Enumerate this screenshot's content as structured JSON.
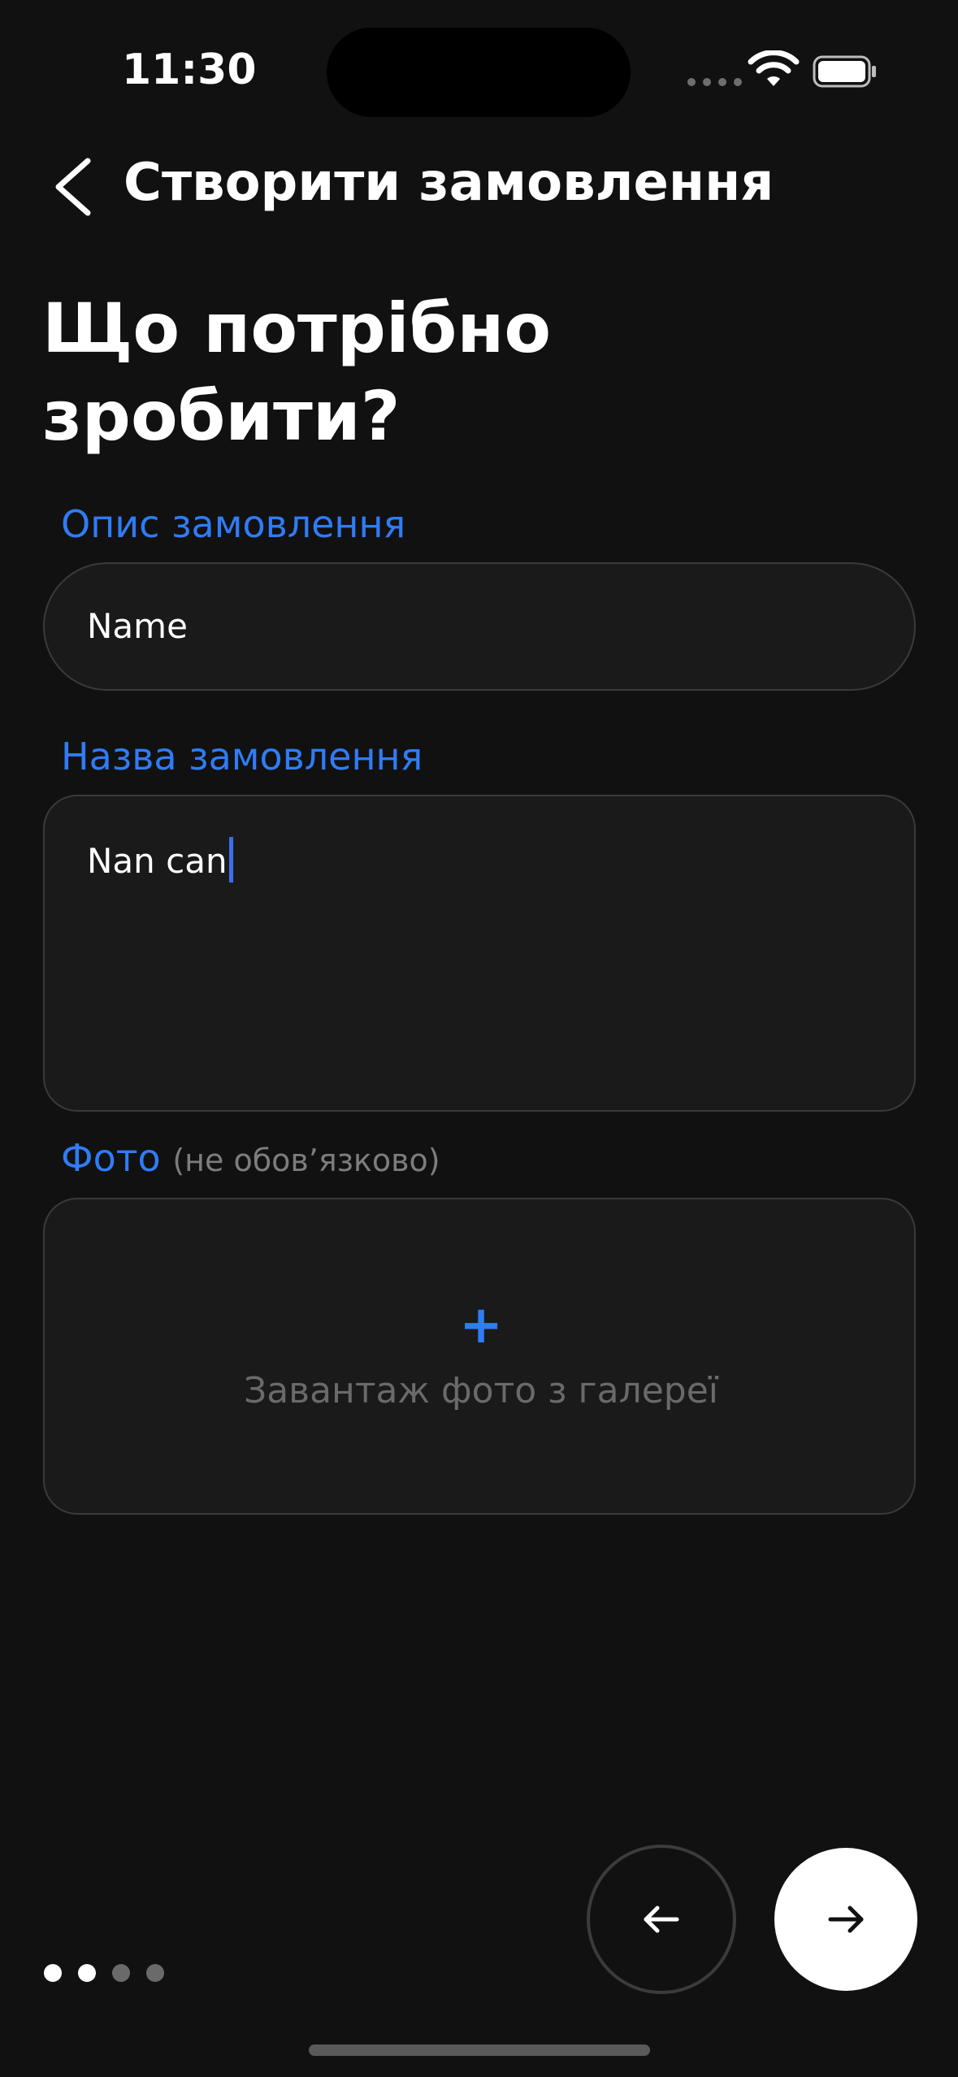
{
  "status_bar": {
    "time": "11:30"
  },
  "nav": {
    "title": "Створити замовлення"
  },
  "heading": "Що потрібно зробити?",
  "description_field": {
    "label": "Опис замовлення",
    "value": "Name"
  },
  "name_field": {
    "label": "Назва замовлення",
    "value": "Nan can"
  },
  "photo": {
    "label": "Фото",
    "optional_note": "(не обов’язково)",
    "upload_text": "Завантаж фото з галереї"
  },
  "pagination": {
    "total": 4,
    "active": [
      true,
      true,
      false,
      false
    ]
  },
  "colors": {
    "accent": "#2f7cf6",
    "background": "#111111",
    "caret": "#3c6ff0"
  },
  "icons": [
    "back-chevron-icon",
    "wifi-icon",
    "battery-icon",
    "arrow-left-icon",
    "arrow-right-icon",
    "plus-icon"
  ]
}
